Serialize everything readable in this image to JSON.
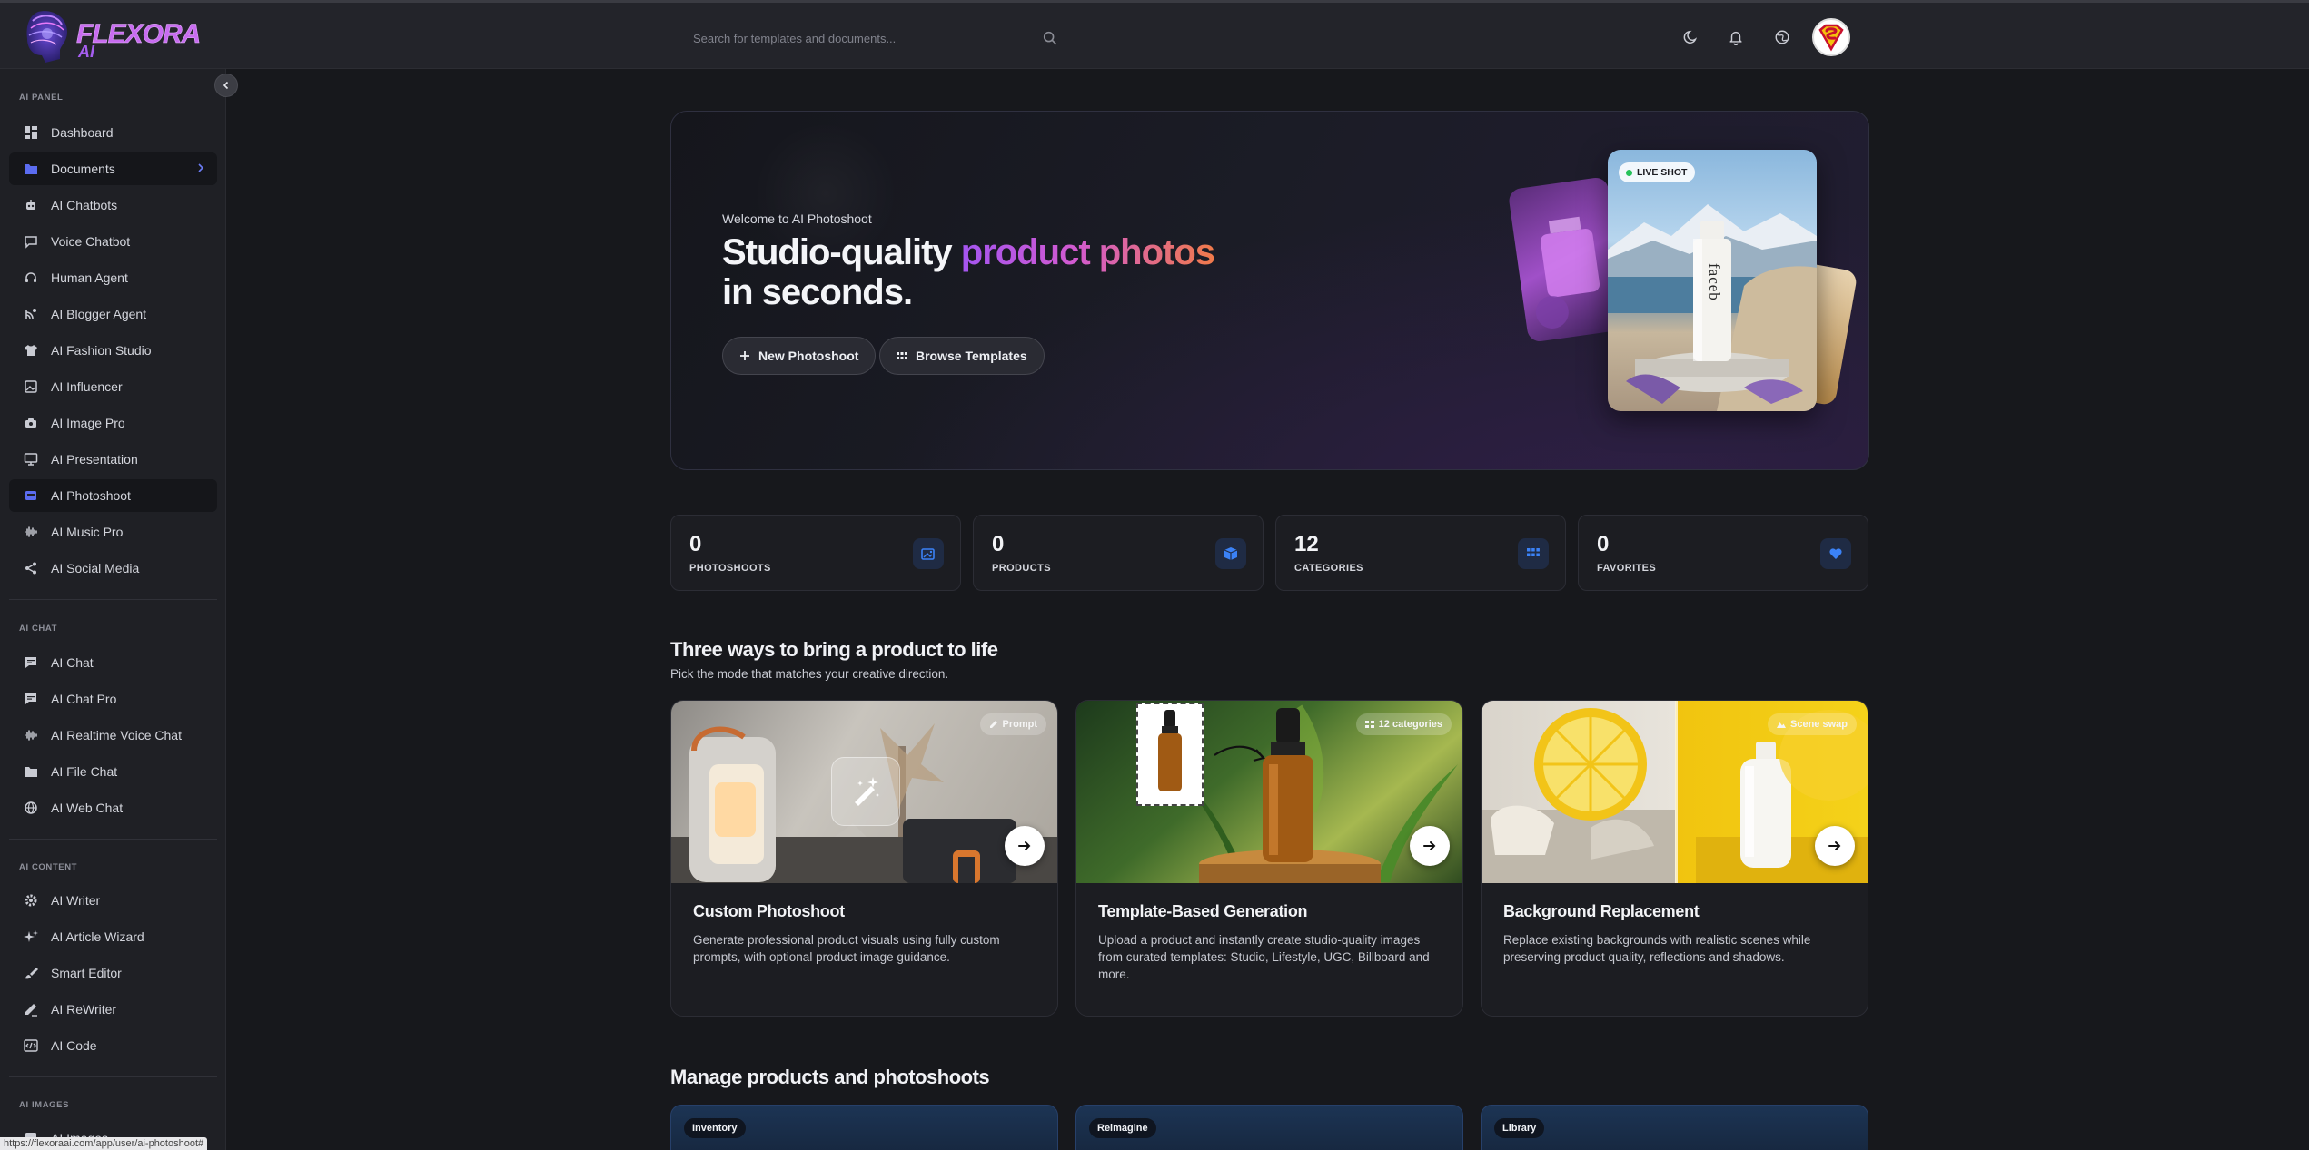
{
  "brand": {
    "name": "FLEXORA",
    "sub": "AI"
  },
  "search": {
    "placeholder": "Search for templates and documents..."
  },
  "sidebar": {
    "sections": [
      {
        "title": "AI PANEL"
      },
      {
        "title": "AI CHAT"
      },
      {
        "title": "AI CONTENT"
      },
      {
        "title": "AI IMAGES"
      }
    ],
    "panel_items": [
      {
        "label": "Dashboard",
        "icon": "dashboard-icon"
      },
      {
        "label": "Documents",
        "icon": "folder-icon"
      },
      {
        "label": "AI Chatbots",
        "icon": "robot-icon"
      },
      {
        "label": "Voice Chatbot",
        "icon": "chat-bubble-icon"
      },
      {
        "label": "Human Agent",
        "icon": "headset-icon"
      },
      {
        "label": "AI Blogger Agent",
        "icon": "blog-icon"
      },
      {
        "label": "AI Fashion Studio",
        "icon": "shirt-icon"
      },
      {
        "label": "AI Influencer",
        "icon": "image-frame-icon"
      },
      {
        "label": "AI Image Pro",
        "icon": "camera-icon"
      },
      {
        "label": "AI Presentation",
        "icon": "presentation-icon"
      },
      {
        "label": "AI Photoshoot",
        "icon": "photoshoot-icon"
      },
      {
        "label": "AI Music Pro",
        "icon": "waveform-icon"
      },
      {
        "label": "AI Social Media",
        "icon": "share-icon"
      }
    ],
    "chat_items": [
      {
        "label": "AI Chat",
        "icon": "message-icon"
      },
      {
        "label": "AI Chat Pro",
        "icon": "message-icon"
      },
      {
        "label": "AI Realtime Voice Chat",
        "icon": "waveform-icon"
      },
      {
        "label": "AI File Chat",
        "icon": "folder-icon"
      },
      {
        "label": "AI Web Chat",
        "icon": "globe-icon"
      }
    ],
    "content_items": [
      {
        "label": "AI Writer",
        "icon": "gear-icon"
      },
      {
        "label": "AI Article Wizard",
        "icon": "sparkles-icon"
      },
      {
        "label": "Smart Editor",
        "icon": "brush-icon"
      },
      {
        "label": "AI ReWriter",
        "icon": "pencil-icon"
      },
      {
        "label": "AI Code",
        "icon": "code-icon"
      }
    ],
    "images_items": [
      {
        "label": "AI Images",
        "icon": "image-icon"
      }
    ]
  },
  "hero": {
    "welcome": "Welcome to AI Photoshoot",
    "title_part1": "Studio-quality ",
    "title_highlight": "product photos",
    "title_line2": "in seconds.",
    "btn_new": "New Photoshoot",
    "btn_browse": "Browse Templates",
    "live_label": "LIVE SHOT",
    "bottle_text": "faceb"
  },
  "stats": [
    {
      "value": "0",
      "label": "PHOTOSHOOTS",
      "icon": "photos-icon"
    },
    {
      "value": "0",
      "label": "PRODUCTS",
      "icon": "box-icon"
    },
    {
      "value": "12",
      "label": "CATEGORIES",
      "icon": "grid-icon"
    },
    {
      "value": "0",
      "label": "FAVORITES",
      "icon": "heart-icon"
    }
  ],
  "modes_section": {
    "title": "Three ways to bring a product to life",
    "subtitle": "Pick the mode that matches your creative direction."
  },
  "modes": [
    {
      "badge": "Prompt",
      "title": "Custom Photoshoot",
      "desc": "Generate professional product visuals using fully custom prompts, with optional product image guidance."
    },
    {
      "badge": "12 categories",
      "title": "Template-Based Generation",
      "desc": "Upload a product and instantly create studio-quality images from curated templates: Studio, Lifestyle, UGC, Billboard and more."
    },
    {
      "badge": "Scene swap",
      "title": "Background Replacement",
      "desc": "Replace existing backgrounds with realistic scenes while preserving product quality, reflections and shadows."
    }
  ],
  "manage_section": {
    "title": "Manage products and photoshoots"
  },
  "manage": [
    {
      "tag": "Inventory"
    },
    {
      "tag": "Reimagine"
    },
    {
      "tag": "Library"
    }
  ],
  "status_url": "https://flexoraai.com/app/user/ai-photoshoot#",
  "colors": {
    "accent": "#3b82f6",
    "brand_purple": "#a855f7",
    "sidebar_bg": "#1f2025",
    "main_bg": "#17181c"
  }
}
